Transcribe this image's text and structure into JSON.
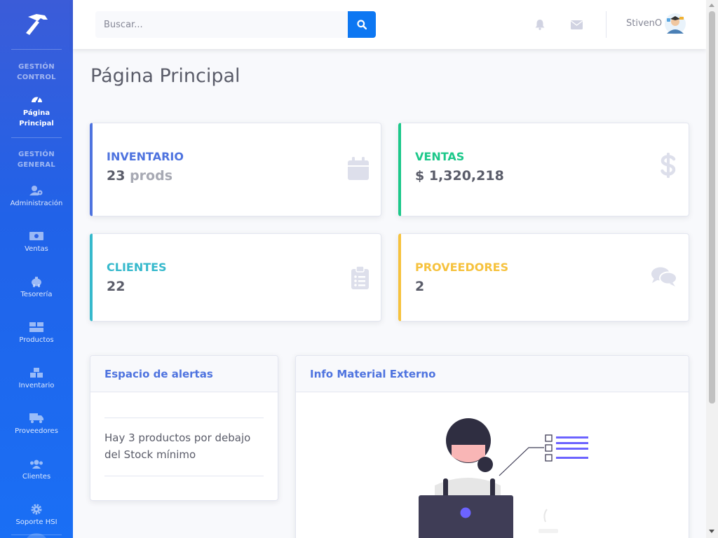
{
  "sidebar": {
    "sections": [
      {
        "heading_line1": "GESTIÓN",
        "heading_line2": "CONTROL"
      },
      {
        "heading_line1": "GESTIÓN",
        "heading_line2": "GENERAL"
      }
    ],
    "items": [
      {
        "label_line1": "Página",
        "label_line2": "Principal",
        "icon": "dashboard-icon",
        "active": true
      },
      {
        "label": "Administración",
        "icon": "users-cog-icon"
      },
      {
        "label": "Ventas",
        "icon": "money-bill-icon"
      },
      {
        "label": "Tesorería",
        "icon": "piggy-bank-icon"
      },
      {
        "label": "Productos",
        "icon": "boxes-icon"
      },
      {
        "label": "Inventario",
        "icon": "cubes-icon"
      },
      {
        "label": "Proveedores",
        "icon": "truck-icon"
      },
      {
        "label": "Clientes",
        "icon": "users-icon"
      },
      {
        "label": "Soporte HSI",
        "icon": "cog-icon"
      }
    ]
  },
  "topbar": {
    "search_placeholder": "Buscar...",
    "username": "StivenO"
  },
  "page": {
    "title": "Página Principal"
  },
  "stats": [
    {
      "label": "INVENTARIO",
      "value": "23",
      "unit": "prods",
      "color": "#4e73df",
      "icon": "calendar-icon"
    },
    {
      "label": "VENTAS",
      "value": "$ 1,320,218",
      "color": "#1cc88a",
      "icon": "dollar-icon"
    },
    {
      "label": "CLIENTES",
      "value": "22",
      "color": "#36b9cc",
      "icon": "clipboard-list-icon"
    },
    {
      "label": "PROVEEDORES",
      "value": "2",
      "color": "#f6c23e",
      "icon": "comments-icon"
    }
  ],
  "alerts": {
    "title": "Espacio de alertas",
    "message": "Hay 3 productos por debajo del Stock mínimo"
  },
  "external": {
    "title": "Info Material Externo"
  }
}
